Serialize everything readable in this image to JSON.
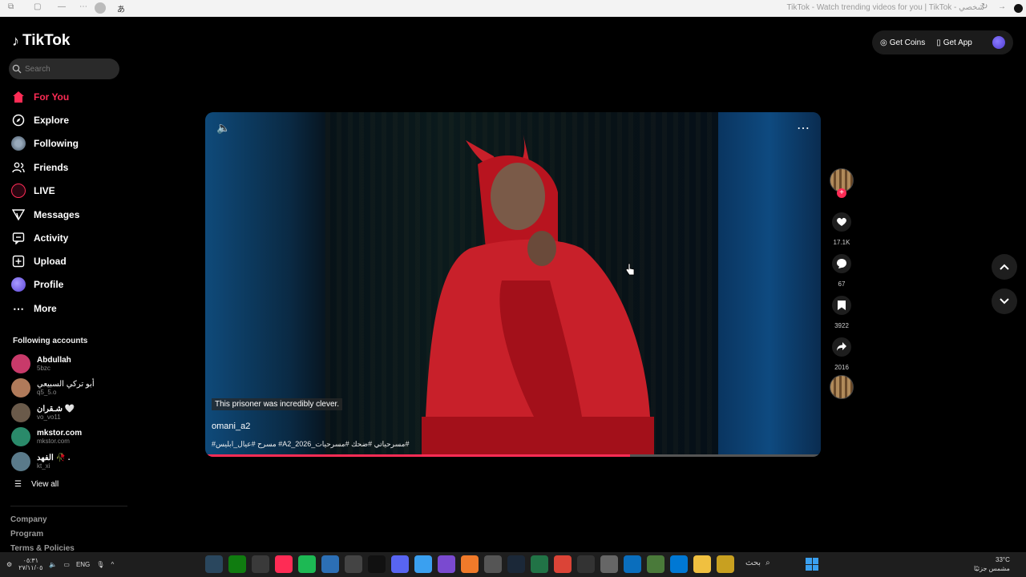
{
  "browser": {
    "title": "TikTok - Watch trending videos for you | TikTok - شخصي"
  },
  "sidebar": {
    "logo": "TikTok",
    "search_placeholder": "Search",
    "nav": [
      {
        "label": "For You",
        "icon": "home-icon",
        "active": true
      },
      {
        "label": "Explore",
        "icon": "compass-icon"
      },
      {
        "label": "Following",
        "icon": "following-avatar-icon"
      },
      {
        "label": "Friends",
        "icon": "friends-icon"
      },
      {
        "label": "LIVE",
        "icon": "live-icon"
      },
      {
        "label": "Messages",
        "icon": "send-icon"
      },
      {
        "label": "Activity",
        "icon": "activity-icon"
      },
      {
        "label": "Upload",
        "icon": "upload-plus-icon"
      },
      {
        "label": "Profile",
        "icon": "profile-avatar-icon"
      },
      {
        "label": "More",
        "icon": "ellipsis-icon"
      }
    ],
    "following_title": "Following accounts",
    "accounts": [
      {
        "name": "Abdullah",
        "handle": "5bzc",
        "color": "#c83a6a"
      },
      {
        "name": "أبو تركي السبيعي",
        "handle": "q5_5.o",
        "color": "#b07a5a"
      },
      {
        "name": "شـقران 🤍",
        "handle": "vo_vo11",
        "color": "#6a5a4a"
      },
      {
        "name": "mkstor.com",
        "handle": "mkstor.com",
        "color": "#2a8a6a"
      },
      {
        "name": "الفهد 🥀 .",
        "handle": "kt_xi",
        "color": "#5a7a8a"
      }
    ],
    "view_all": "View all",
    "footer": [
      "Company",
      "Program",
      "Terms & Policies"
    ]
  },
  "top_right": {
    "coins": "Get Coins",
    "app": "Get App"
  },
  "video": {
    "caption": "This prisoner was incredibly clever.",
    "username": "omani_a2",
    "tags": "#مسرح #عيال_ابليس #A2_مسرحياتي #ضحك #مسرحيات_2026#",
    "progress": 0.69
  },
  "actions": {
    "likes": "17.1K",
    "comments": "67",
    "saves": "3922",
    "shares": "2016"
  },
  "taskbar": {
    "language": "ENG",
    "time": "٠٥:٣١",
    "date": "٢٧/١١/٠٥",
    "search_label": "بحث",
    "temperature": "33°C",
    "weather": "مشمس جزئيًا"
  }
}
